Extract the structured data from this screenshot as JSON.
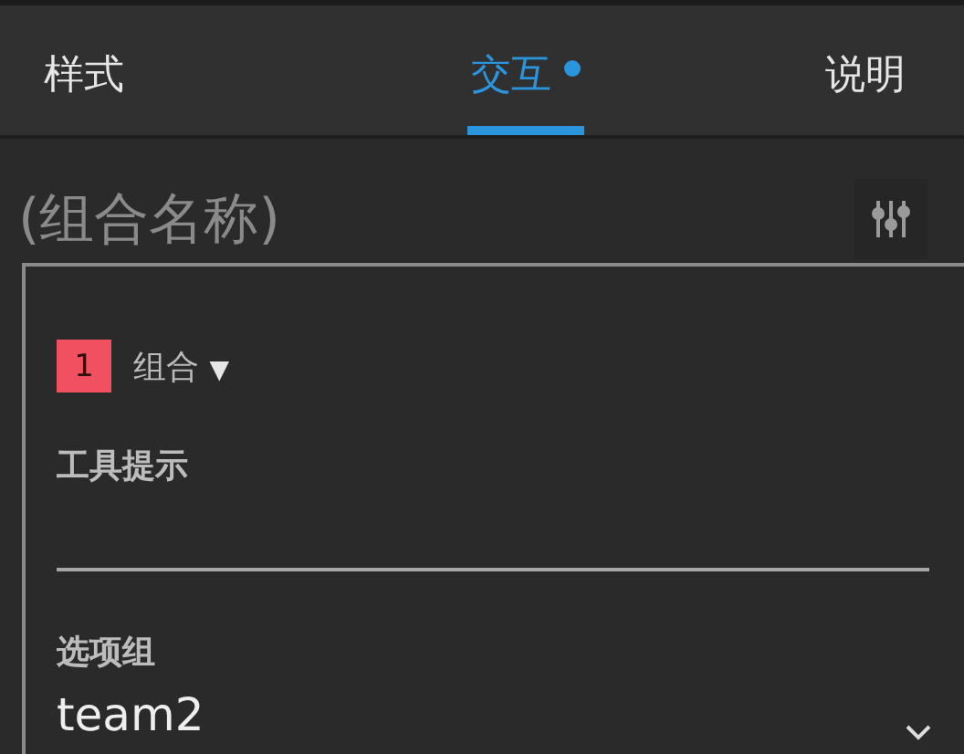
{
  "tabs": [
    {
      "label": "样式",
      "selected": false,
      "dot": false
    },
    {
      "label": "交互",
      "selected": true,
      "dot": true
    },
    {
      "label": "说明",
      "selected": false,
      "dot": false
    }
  ],
  "name_field": {
    "placeholder": "(组合名称)"
  },
  "panel": {
    "badge": "1",
    "group_label": "组合",
    "group_caret": "▼",
    "tooltip": {
      "label": "工具提示"
    },
    "option_group": {
      "label": "选项组",
      "value": "team2"
    }
  }
}
